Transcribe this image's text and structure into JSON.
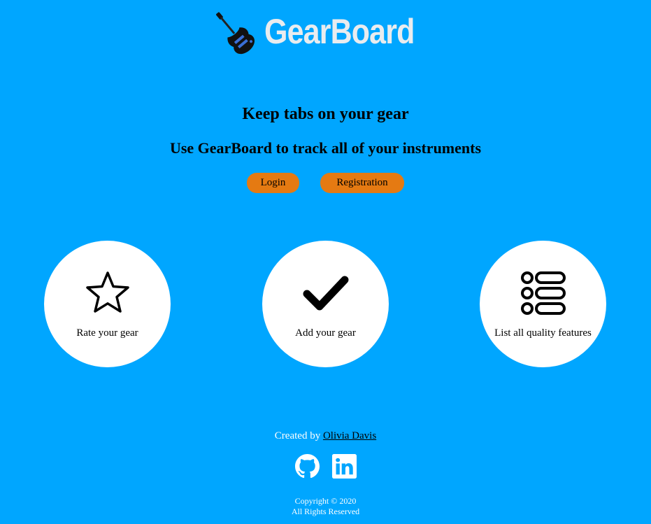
{
  "brand": {
    "name": "GearBoard",
    "logo_icon": "electric-guitar-icon",
    "name_color": "#e9ecef"
  },
  "hero": {
    "headline": "Keep tabs on your gear",
    "subheadline": "Use GearBoard to track all of your instruments"
  },
  "auth": {
    "login_label": "Login",
    "register_label": "Registration",
    "button_color": "#e57a12"
  },
  "features": [
    {
      "icon": "star-icon",
      "label": "Rate your gear"
    },
    {
      "icon": "checkmark-icon",
      "label": "Add your gear"
    },
    {
      "icon": "list-icon",
      "label": "List all quality features"
    }
  ],
  "footer": {
    "created_by_prefix": "Created by",
    "author": "Olivia Davis",
    "social": [
      "github-icon",
      "linkedin-icon"
    ],
    "copyright": "Copyright © 2020",
    "rights": "All Rights Reserved"
  },
  "colors": {
    "background": "#00a6ff",
    "card": "#ffffff"
  }
}
